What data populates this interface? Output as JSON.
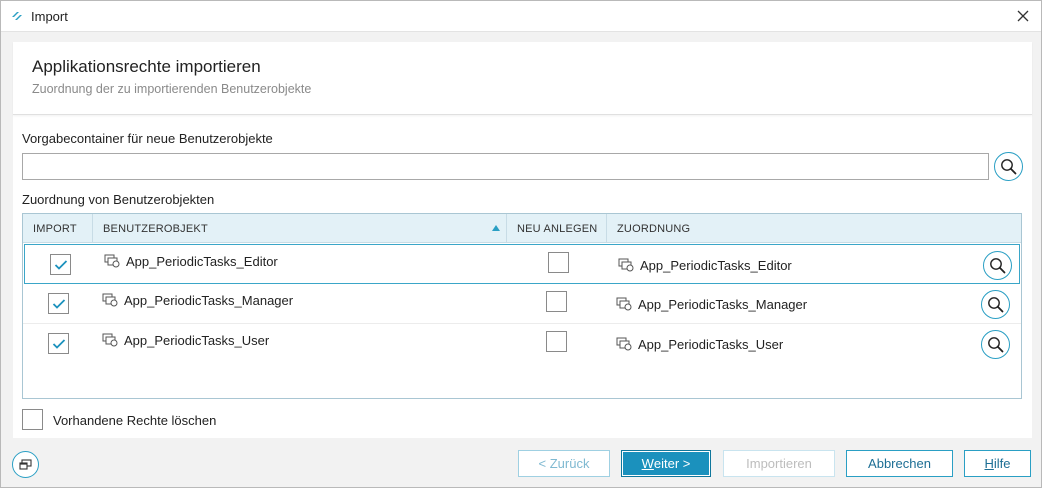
{
  "window": {
    "title": "Import"
  },
  "header": {
    "title": "Applikationsrechte importieren",
    "subtitle": "Zuordnung der zu importierenden Benutzerobjekte"
  },
  "container": {
    "label": "Vorgabecontainer für neue Benutzerobjekte",
    "value": "",
    "placeholder": ""
  },
  "assignment": {
    "label": "Zuordnung von Benutzerobjekten",
    "columns": {
      "import": "IMPORT",
      "object": "BENUTZEROBJEKT",
      "new": "NEU ANLEGEN",
      "mapping": "ZUORDNUNG"
    },
    "sort": {
      "column": "BENUTZEROBJEKT",
      "direction": "ascending"
    },
    "rows": [
      {
        "import": true,
        "object": "App_PeriodicTasks_Editor",
        "new": false,
        "mapping": "App_PeriodicTasks_Editor",
        "selected": true
      },
      {
        "import": true,
        "object": "App_PeriodicTasks_Manager",
        "new": false,
        "mapping": "App_PeriodicTasks_Manager",
        "selected": false
      },
      {
        "import": true,
        "object": "App_PeriodicTasks_User",
        "new": false,
        "mapping": "App_PeriodicTasks_User",
        "selected": false
      }
    ]
  },
  "options": {
    "delete_label": "Vorhandene Rechte löschen",
    "delete_checked": false
  },
  "footer": {
    "back": "< Zurück",
    "next_prefix": "",
    "next_mnemonic": "W",
    "next_rest": "eiter >",
    "import": "Importieren",
    "cancel": "Abbrechen",
    "help_mnemonic": "H",
    "help_rest": "ilfe"
  },
  "colors": {
    "accent": "#2a9fc4",
    "primary_button": "#1b91bd",
    "header_bg": "#e3f1f7"
  },
  "icons": [
    "app-logo-icon",
    "close-icon",
    "search-icon",
    "user-object-icon",
    "check-icon",
    "sort-ascending-icon",
    "window-mode-icon"
  ]
}
